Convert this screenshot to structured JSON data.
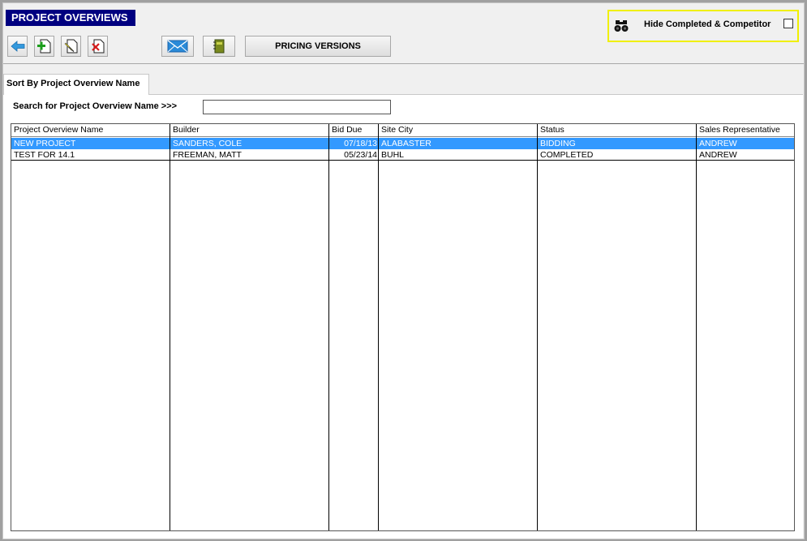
{
  "title": "PROJECT OVERVIEWS",
  "toolbar": {
    "icons": [
      "back-arrow-icon",
      "add-document-icon",
      "edit-document-icon",
      "delete-document-icon",
      "email-icon",
      "notebook-icon"
    ],
    "pricing_label": "PRICING VERSIONS"
  },
  "filter": {
    "label": "Hide Completed & Competitor",
    "checked": false,
    "icon": "binoculars-icon"
  },
  "tab": {
    "label": "Sort By Project Overview Name"
  },
  "search": {
    "label": "Search for Project Overview Name >>>",
    "value": "",
    "placeholder": ""
  },
  "table": {
    "columns": [
      "Project Overview Name",
      "Builder",
      "Bid Due",
      "Site City",
      "Status",
      "Sales Representative"
    ],
    "rows": [
      {
        "name": "NEW PROJECT",
        "builder": "SANDERS, COLE",
        "bid_due": "07/18/13",
        "city": "ALABASTER",
        "status": "BIDDING",
        "rep": "ANDREW",
        "selected": true
      },
      {
        "name": "TEST FOR 14.1",
        "builder": "FREEMAN, MATT",
        "bid_due": "05/23/14",
        "city": "BUHL",
        "status": "COMPLETED",
        "rep": "ANDREW",
        "selected": false
      }
    ]
  },
  "colors": {
    "title_bg": "#000080",
    "selection": "#3399ff",
    "filter_border": "#f0f000",
    "back_arrow": "#3399dd"
  }
}
